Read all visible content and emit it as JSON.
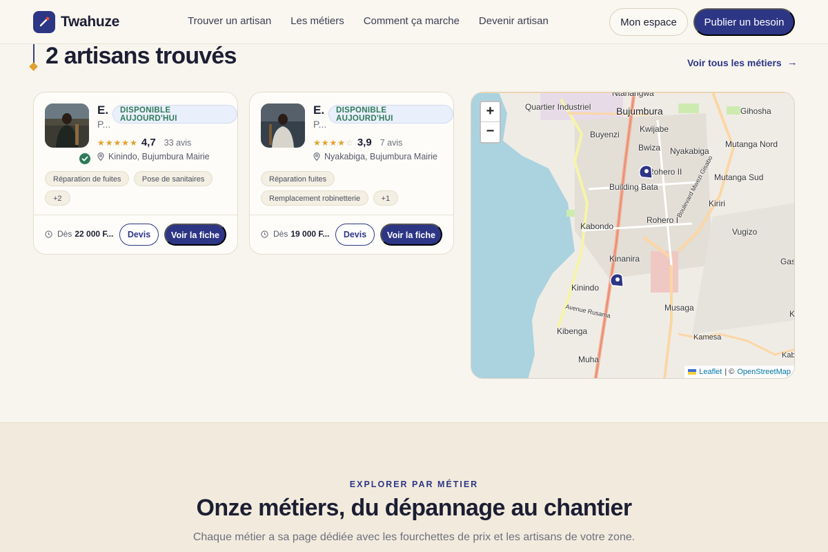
{
  "header": {
    "brand": "Twahuze",
    "nav": [
      "Trouver un artisan",
      "Les métiers",
      "Comment ça marche",
      "Devenir artisan"
    ],
    "account_button": "Mon espace",
    "cta_button": "Publier un besoin"
  },
  "results": {
    "title": "2 artisans trouvés",
    "see_all": "Voir tous les métiers",
    "see_all_arrow": "→"
  },
  "artisans": [
    {
      "name": "E.",
      "trade": "P...",
      "availability": "DISPONIBLE AUJOURD'HUI",
      "rating": "4,7",
      "stars": 5,
      "reviews": "33 avis",
      "verified": true,
      "location": "Kinindo, Bujumbura Mairie",
      "tags": [
        "Réparation de fuites",
        "Pose de sanitaires",
        "+2"
      ],
      "price_prefix": "Dès",
      "price": "22 000 F...",
      "devis": "Devis",
      "profile": "Voir la fiche"
    },
    {
      "name": "E.",
      "trade": "P...",
      "availability": "DISPONIBLE AUJOURD'HUI",
      "rating": "3,9",
      "stars": 4,
      "reviews": "7 avis",
      "verified": false,
      "location": "Nyakabiga, Bujumbura Mairie",
      "tags": [
        "Réparation fuites",
        "Remplacement robinetterie",
        "+1"
      ],
      "price_prefix": "Dès",
      "price": "19 000 F...",
      "devis": "Devis",
      "profile": "Voir la fiche"
    }
  ],
  "map": {
    "zoom_in": "+",
    "zoom_out": "−",
    "labels": [
      "Ntahangwa",
      "Quartier Industriel",
      "Bujumbura",
      "Gihosha",
      "Buyenzi",
      "Kwijabe",
      "Bwiza",
      "Nyakabiga",
      "Mutanga Nord",
      "Rohero II",
      "Building Bata",
      "Mutanga Sud",
      "Kiriri",
      "Rohero I",
      "Kabondo",
      "Vugizo",
      "Kinanira",
      "Gas",
      "Kinindo",
      "Musaga",
      "K",
      "Avenue Rusama",
      "Kibenga",
      "Kamesa",
      "Kab",
      "Muha",
      "Boulevard Mwezi Gisabo"
    ],
    "attribution_leaflet": "Leaflet",
    "attribution_sep": "| ©",
    "attribution_osm": "OpenStreetMap"
  },
  "explore": {
    "eyebrow": "EXPLORER PAR MÉTIER",
    "title": "Onze métiers, du dépannage au chantier",
    "subtitle": "Chaque métier a sa page dédiée avec les fourchettes de prix et les artisans de votre zone."
  },
  "colors": {
    "primary": "#2d3585",
    "accent": "#e0a12d",
    "success": "#2f7a59",
    "background": "#f8f5ee"
  }
}
